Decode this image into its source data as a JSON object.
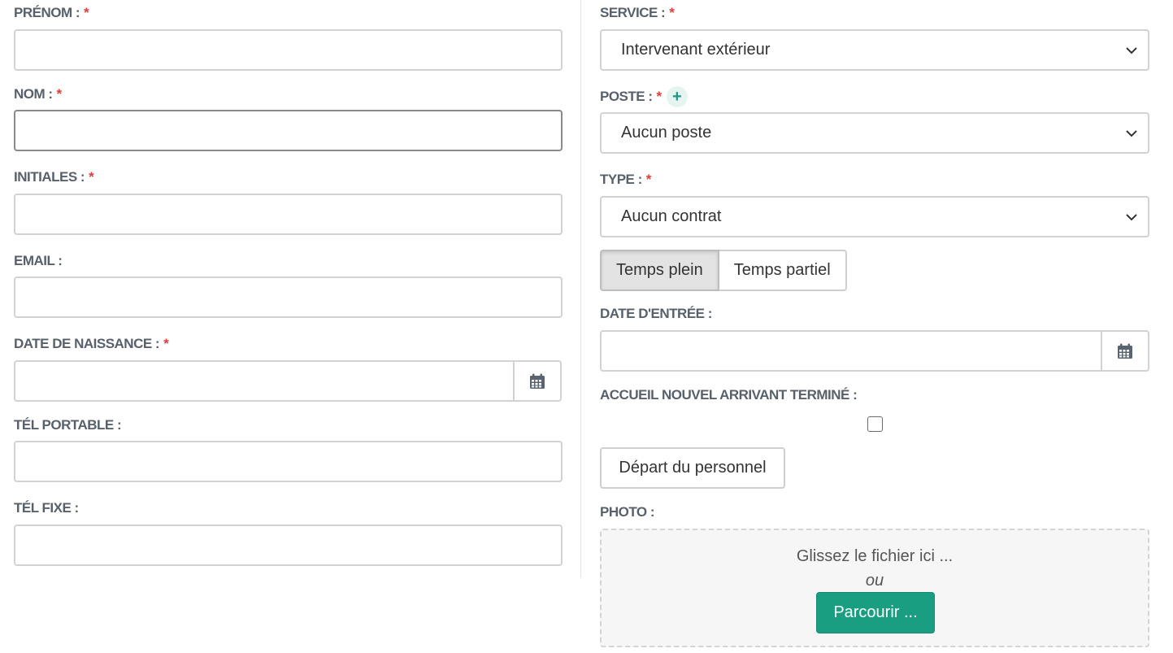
{
  "left": {
    "prenom_label": "PRÉNOM :",
    "nom_label": "NOM :",
    "initiales_label": "INITIALES :",
    "email_label": "EMAIL :",
    "date_naissance_label": "DATE DE NAISSANCE :",
    "tel_portable_label": "TÉL PORTABLE :",
    "tel_fixe_label": "TÉL FIXE :"
  },
  "right": {
    "service_label": "SERVICE :",
    "service_value": "Intervenant extérieur",
    "poste_label": "POSTE :",
    "poste_value": "Aucun poste",
    "type_label": "TYPE :",
    "type_value": "Aucun contrat",
    "temps_plein": "Temps plein",
    "temps_partiel": "Temps partiel",
    "date_entree_label": "DATE D'ENTRÉE :",
    "accueil_label": "ACCUEIL NOUVEL ARRIVANT TERMINÉ :",
    "depart_button": "Départ du personnel",
    "photo_label": "PHOTO :",
    "dropzone_text": "Glissez le fichier ici ...",
    "dropzone_or": "ou",
    "browse_button": "Parcourir ..."
  },
  "required_marker": "*",
  "plus_symbol": "+",
  "icons": {
    "calendar": "calendar-icon",
    "chevron": "chevron-down-icon",
    "plus": "plus-icon"
  },
  "colors": {
    "required": "#e03c3c",
    "primary": "#1a9e82",
    "label": "#58616b"
  }
}
